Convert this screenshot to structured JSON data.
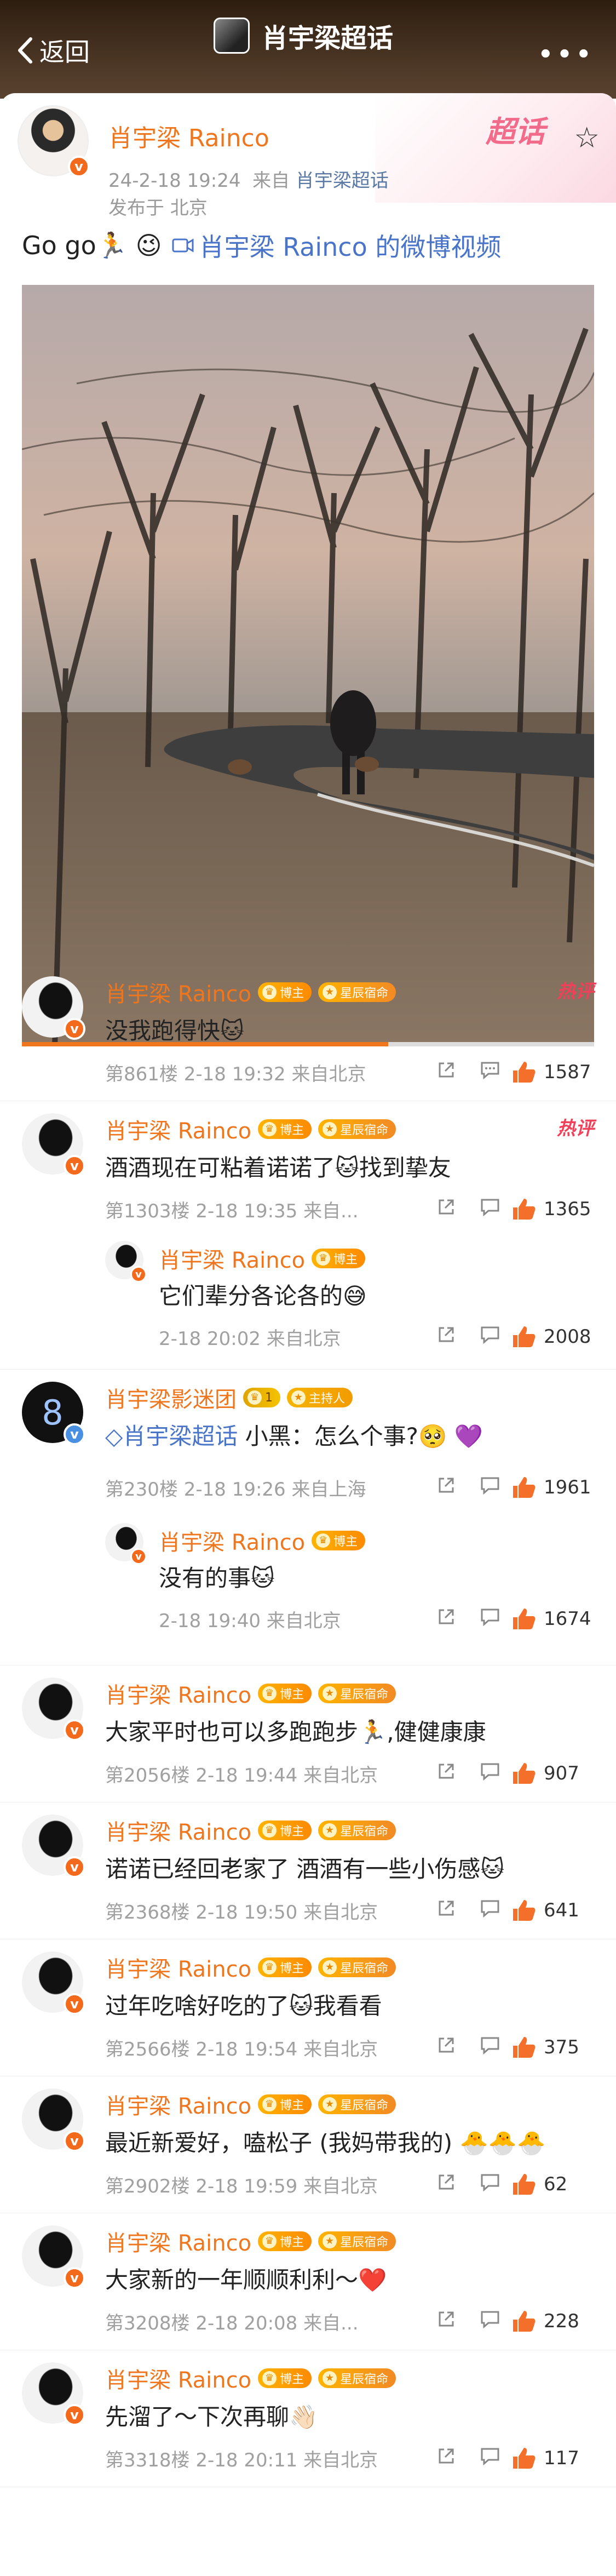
{
  "header": {
    "back_label": "返回",
    "title": "肖宇梁超话"
  },
  "post": {
    "topic_badge": "超话",
    "author": "肖宇梁 Rainco",
    "date": "24-2-18 19:24",
    "source_prefix": "来自",
    "source": "肖宇梁超话",
    "location": "发布于 北京",
    "text": "Go go🏃 😉",
    "video_link": "肖宇梁 Rainco 的微博视频",
    "video_progress": 0.64
  },
  "comments": [
    {
      "name": "肖宇梁 Rainco",
      "tags": [
        "博主",
        "星辰宿命"
      ],
      "hot": "热评",
      "text": "没我跑得快🐱",
      "floor": "第861楼",
      "time": "2-18 19:32",
      "from": "来自北京",
      "likes": "1587"
    },
    {
      "name": "肖宇梁 Rainco",
      "tags": [
        "博主",
        "星辰宿命"
      ],
      "hot": "热评",
      "text": "酒酒现在可粘着诺诺了🐱找到挚友",
      "floor": "第1303楼",
      "time": "2-18 19:35",
      "from": "来自...",
      "likes": "1365",
      "reply": {
        "name": "肖宇梁 Rainco",
        "tag": "博主",
        "text": "它们辈分各论各的😅",
        "time": "2-18 20:02",
        "from": "来自北京",
        "likes": "2008"
      }
    },
    {
      "name": "肖宇梁影迷团",
      "level": "1",
      "host_tag": "主持人",
      "text_prefix": "肖宇梁超话",
      "text": " 小黑：怎么个事?🥺",
      "floor": "第230楼",
      "time": "2-18 19:26",
      "from": "来自上海",
      "likes": "1961",
      "reply": {
        "name": "肖宇梁 Rainco",
        "tag": "博主",
        "text": "没有的事🐱",
        "time": "2-18 19:40",
        "from": "来自北京",
        "likes": "1674"
      }
    },
    {
      "name": "肖宇梁 Rainco",
      "tags": [
        "博主",
        "星辰宿命"
      ],
      "text": "大家平时也可以多跑跑步🏃,健健康康",
      "floor": "第2056楼",
      "time": "2-18 19:44",
      "from": "来自北京",
      "likes": "907"
    },
    {
      "name": "肖宇梁 Rainco",
      "tags": [
        "博主",
        "星辰宿命"
      ],
      "text": "诺诺已经回老家了 酒酒有一些小伤感🐱",
      "floor": "第2368楼",
      "time": "2-18 19:50",
      "from": "来自北京",
      "likes": "641"
    },
    {
      "name": "肖宇梁 Rainco",
      "tags": [
        "博主",
        "星辰宿命"
      ],
      "text": "过年吃啥好吃的了🐱我看看",
      "floor": "第2566楼",
      "time": "2-18 19:54",
      "from": "来自北京",
      "likes": "375"
    },
    {
      "name": "肖宇梁 Rainco",
      "tags": [
        "博主",
        "星辰宿命"
      ],
      "text": "最近新爱好，嗑松子 (我妈带我的) 🐣🐣🐣",
      "floor": "第2902楼",
      "time": "2-18 19:59",
      "from": "来自北京",
      "likes": "62"
    },
    {
      "name": "肖宇梁 Rainco",
      "tags": [
        "博主",
        "星辰宿命"
      ],
      "text": "大家新的一年顺顺利利～❤️",
      "floor": "第3208楼",
      "time": "2-18 20:08",
      "from": "来自...",
      "likes": "228"
    },
    {
      "name": "肖宇梁 Rainco",
      "tags": [
        "博主",
        "星辰宿命"
      ],
      "text": "先溜了～下次再聊👋🏻",
      "floor": "第3318楼",
      "time": "2-18 20:11",
      "from": "来自北京",
      "likes": "117"
    }
  ]
}
